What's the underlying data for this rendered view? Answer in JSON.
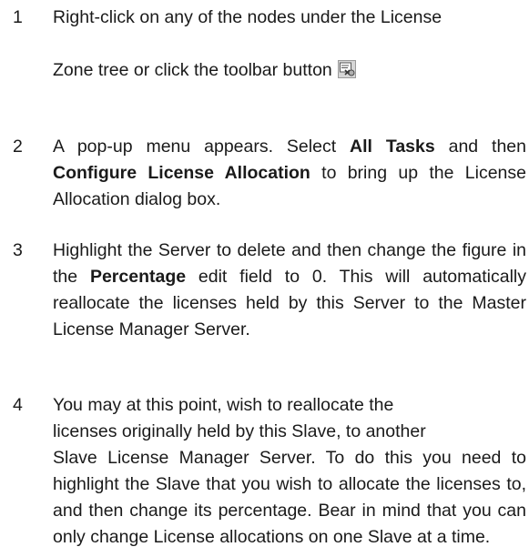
{
  "steps": [
    {
      "number": "1",
      "line1": "Right-click on any of the nodes under the License",
      "line2": "Zone tree or click the toolbar button",
      "icon": "license-toolbar-icon"
    },
    {
      "number": "2",
      "t1": "A pop-up menu appears. Select ",
      "b1": "All Tasks",
      "t2": " and then ",
      "b2": "Configure License Allocation",
      "t3": " to bring up the License Allocation dialog box."
    },
    {
      "number": "3",
      "t1": "Highlight the Server to delete and then change the figure in the ",
      "b1": "Percentage",
      "t2": " edit field to 0. This will automatically reallocate the licenses held by this Server to the Master License Manager Server."
    },
    {
      "number": "4",
      "line1": "You may at this point, wish to reallocate the",
      "line2": "licenses originally held by this Slave, to another",
      "rest": "Slave License Manager Server. To do this you need to highlight the Slave that you wish to allo­cate the licenses to, and then change its percent­age. Bear in mind that you can only change License allocations on one Slave at a time."
    }
  ]
}
